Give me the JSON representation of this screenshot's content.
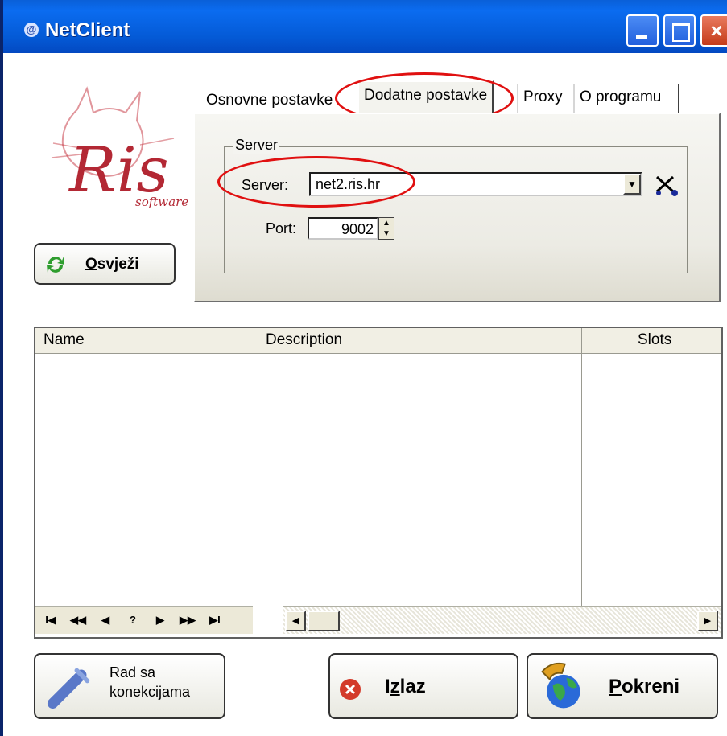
{
  "window": {
    "title": "NetClient",
    "app_icon": "@"
  },
  "titlebar_buttons": {
    "close_glyph": "×"
  },
  "logo": {
    "brand": "Ris",
    "subtitle": "software"
  },
  "tabs": [
    {
      "label": "Osnovne postavke",
      "active": false
    },
    {
      "label": "Dodatne postavke",
      "active": true
    },
    {
      "label": "Proxy",
      "active": false
    },
    {
      "label": "O programu",
      "active": false
    }
  ],
  "server_group": {
    "legend": "Server",
    "server_label": "Server:",
    "server_value": "net2.ris.hr",
    "port_label": "Port:",
    "port_value": "9002"
  },
  "refresh_button": {
    "key": "O",
    "rest": "svježi"
  },
  "grid": {
    "columns": [
      "Name",
      "Description",
      "Slots"
    ],
    "rows": []
  },
  "navigator": {
    "buttons": [
      "I◀",
      "◀◀",
      "◀",
      "?",
      "▶",
      "▶▶",
      "▶I"
    ]
  },
  "buttons": {
    "rad_line1": "Rad sa",
    "rad_line2": "konekcijama",
    "izlaz_key": "I",
    "izlaz_key2": "z",
    "izlaz_rest": "laz",
    "pokreni_key": "P",
    "pokreni_rest": "okreni"
  },
  "colors": {
    "titlebar": "#0b6cf0",
    "annotation_red": "#e01010",
    "window_face": "#ece9d8"
  },
  "icons": {
    "refresh": "refresh-icon",
    "tool": "scissors-icon",
    "rad": "connector-icon",
    "izlaz": "close-circle-icon",
    "pokreni": "globe-phone-icon"
  }
}
